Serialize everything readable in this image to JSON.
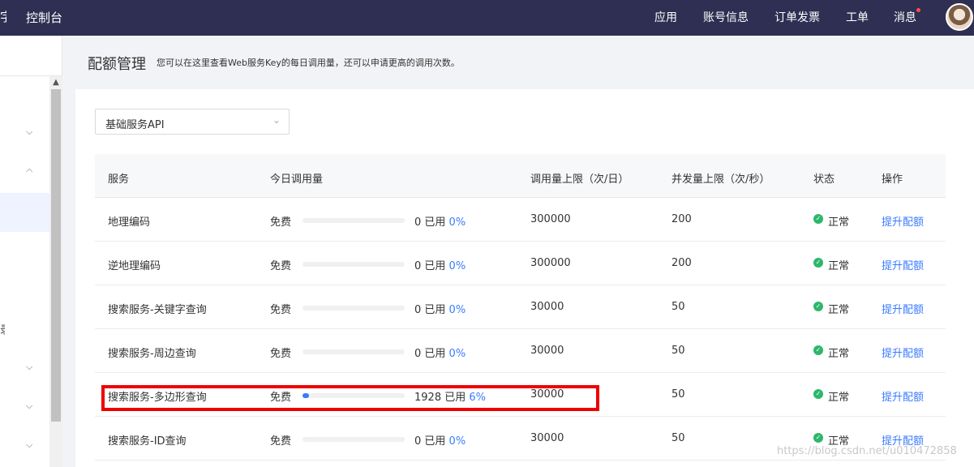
{
  "topbar": {
    "brand_cut": "字",
    "brand": "控制台",
    "nav": [
      "应用",
      "账号信息",
      "订单发票",
      "工单",
      "消息"
    ]
  },
  "sidebar": {
    "cut_text": "录"
  },
  "page": {
    "title": "配额管理",
    "description": "您可以在这里查看Web服务Key的每日调用量，还可以申请更高的调用次数。"
  },
  "select": {
    "value": "基础服务API"
  },
  "table": {
    "headers": [
      "服务",
      "今日调用量",
      "调用量上限（次/日）",
      "并发量上限（次/秒）",
      "状态",
      "操作"
    ],
    "rows": [
      {
        "service": "地理编码",
        "tier": "免费",
        "used": "0 已用",
        "pct": "0%",
        "fill": 0,
        "limit": "300000",
        "concurrency": "200",
        "status": "正常",
        "action": "提升配额"
      },
      {
        "service": "逆地理编码",
        "tier": "免费",
        "used": "0 已用",
        "pct": "0%",
        "fill": 0,
        "limit": "300000",
        "concurrency": "200",
        "status": "正常",
        "action": "提升配额"
      },
      {
        "service": "搜索服务-关键字查询",
        "tier": "免费",
        "used": "0 已用",
        "pct": "0%",
        "fill": 0,
        "limit": "30000",
        "concurrency": "50",
        "status": "正常",
        "action": "提升配额"
      },
      {
        "service": "搜索服务-周边查询",
        "tier": "免费",
        "used": "0 已用",
        "pct": "0%",
        "fill": 0,
        "limit": "30000",
        "concurrency": "50",
        "status": "正常",
        "action": "提升配额"
      },
      {
        "service": "搜索服务-多边形查询",
        "tier": "免费",
        "used": "1928 已用",
        "pct": "6%",
        "fill": 6,
        "limit": "30000",
        "concurrency": "50",
        "status": "正常",
        "action": "提升配额"
      },
      {
        "service": "搜索服务-ID查询",
        "tier": "免费",
        "used": "0 已用",
        "pct": "0%",
        "fill": 0,
        "limit": "30000",
        "concurrency": "50",
        "status": "正常",
        "action": "提升配额"
      }
    ]
  },
  "watermark": "https://blog.csdn.net/u010472858",
  "colors": {
    "nav_bg": "#2e2f52",
    "accent": "#3a7bff",
    "ok": "#2db76a",
    "highlight": "#ee0000"
  }
}
